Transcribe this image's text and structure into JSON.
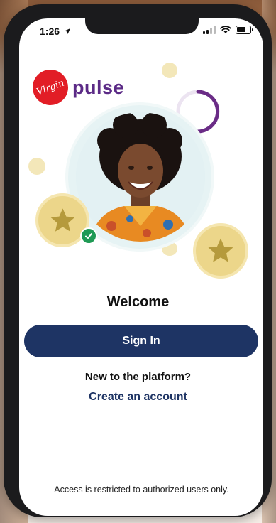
{
  "status_bar": {
    "time": "1:26",
    "icons": [
      "location-arrow-icon",
      "signal-icon",
      "wifi-icon",
      "battery-icon"
    ],
    "battery_label": "6"
  },
  "brand": {
    "badge_text": "Virgin",
    "wordmark": "pulse",
    "colors": {
      "badge": "#e21d26",
      "wordmark": "#5b2a86"
    }
  },
  "hero": {
    "avatar": "woman-smiling-photo",
    "badge": "check-icon",
    "decorations": [
      "star-coin",
      "star-coin",
      "progress-ring"
    ]
  },
  "main": {
    "welcome": "Welcome",
    "signin_label": "Sign In",
    "new_prompt": "New to the platform?",
    "create_account": "Create an account",
    "restricted": "Access is restricted to authorized users only."
  },
  "colors": {
    "primary": "#1e3464",
    "success": "#1f9a55",
    "coin": "#ecd68a"
  }
}
